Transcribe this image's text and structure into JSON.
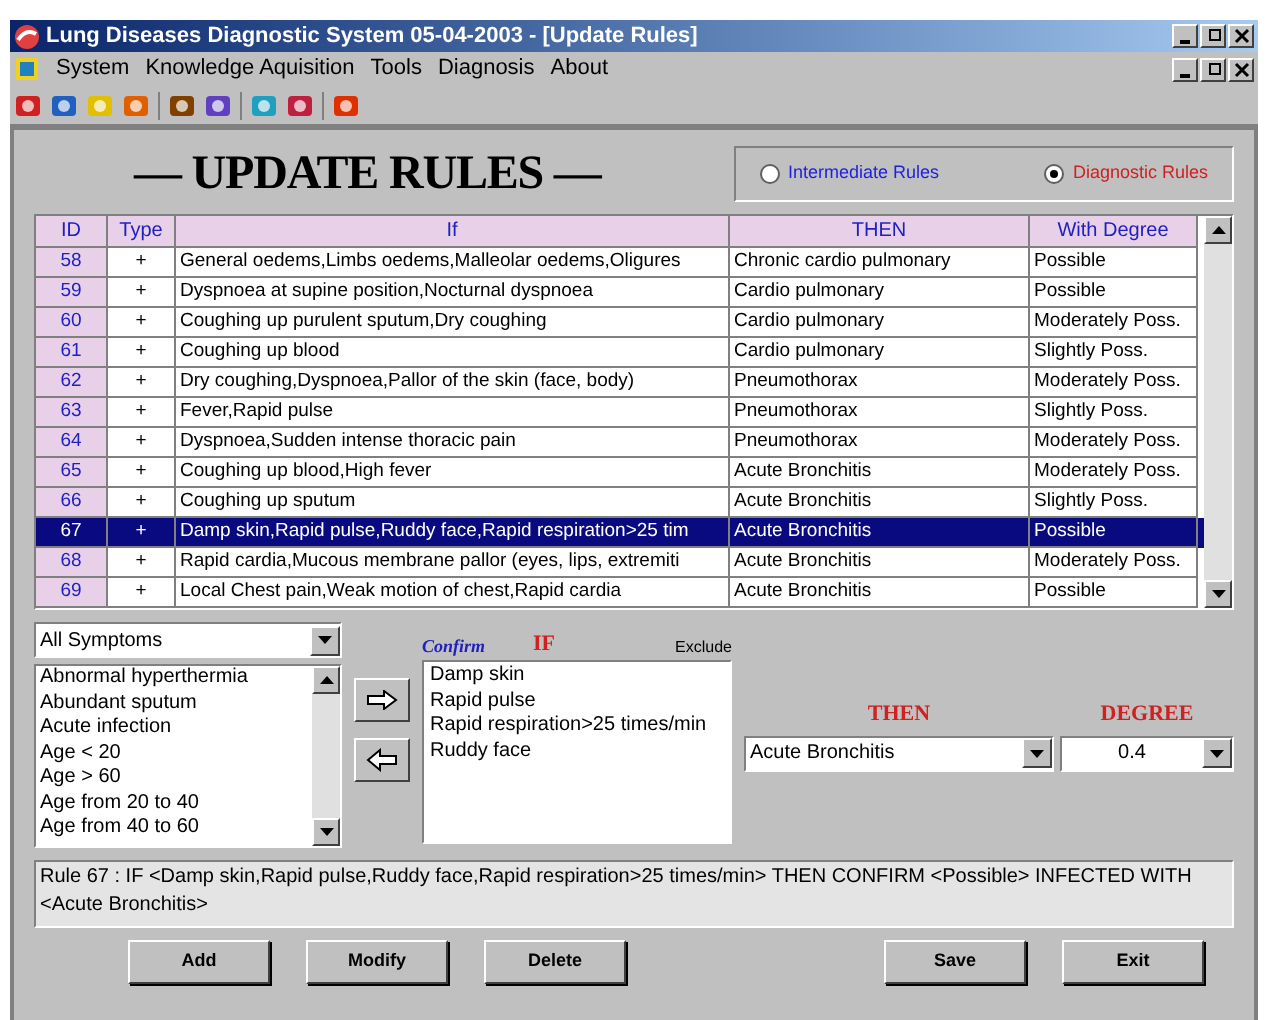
{
  "window": {
    "title": "Lung Diseases Diagnostic System 05-04-2003 - [Update Rules]"
  },
  "menu": [
    "System",
    "Knowledge Aquisition",
    "Tools",
    "Diagnosis",
    "About"
  ],
  "heading": "— UPDATE RULES —",
  "rule_types": [
    {
      "label": "Intermediate Rules",
      "selected": false,
      "color": "#2020e0"
    },
    {
      "label": "Diagnostic Rules",
      "selected": true,
      "color": "#d02020"
    }
  ],
  "table": {
    "columns": [
      "ID",
      "Type",
      "If",
      "THEN",
      "With Degree"
    ],
    "rows": [
      {
        "cells": [
          "58",
          "+",
          "General oedems,Limbs oedems,Malleolar oedems,Oligures",
          "Chronic cardio pulmonary",
          "Possible"
        ],
        "selected": false
      },
      {
        "cells": [
          "59",
          "+",
          "Dyspnoea at supine position,Nocturnal dyspnoea",
          "Cardio pulmonary",
          "Possible"
        ],
        "selected": false
      },
      {
        "cells": [
          "60",
          "+",
          "Coughing up purulent sputum,Dry coughing",
          "Cardio pulmonary",
          "Moderately Poss."
        ],
        "selected": false
      },
      {
        "cells": [
          "61",
          "+",
          "Coughing up blood",
          "Cardio pulmonary",
          "Slightly Poss."
        ],
        "selected": false
      },
      {
        "cells": [
          "62",
          "+",
          "Dry coughing,Dyspnoea,Pallor of the skin (face, body)",
          "Pneumothorax",
          "Moderately Poss."
        ],
        "selected": false
      },
      {
        "cells": [
          "63",
          "+",
          "Fever,Rapid pulse",
          "Pneumothorax",
          "Slightly Poss."
        ],
        "selected": false
      },
      {
        "cells": [
          "64",
          "+",
          "Dyspnoea,Sudden intense thoracic pain",
          "Pneumothorax",
          "Moderately Poss."
        ],
        "selected": false
      },
      {
        "cells": [
          "65",
          "+",
          "Coughing up blood,High fever",
          "Acute Bronchitis",
          "Moderately Poss."
        ],
        "selected": false
      },
      {
        "cells": [
          "66",
          "+",
          "Coughing up sputum",
          "Acute Bronchitis",
          "Slightly Poss."
        ],
        "selected": false
      },
      {
        "cells": [
          "67",
          "+",
          "Damp skin,Rapid pulse,Ruddy face,Rapid respiration>25 tim",
          "Acute Bronchitis",
          "Possible"
        ],
        "selected": true
      },
      {
        "cells": [
          "68",
          "+",
          "Rapid cardia,Mucous membrane pallor (eyes, lips, extremiti",
          "Acute Bronchitis",
          "Moderately Poss."
        ],
        "selected": false
      },
      {
        "cells": [
          "69",
          "+",
          "Local Chest pain,Weak motion of chest,Rapid cardia",
          "Acute Bronchitis",
          "Possible"
        ],
        "selected": false
      }
    ]
  },
  "symptom_filter": "All Symptoms",
  "symptoms": [
    "Abnormal hyperthermia",
    "Abundant sputum",
    "Acute infection",
    "Age < 20",
    "Age > 60",
    "Age from 20 to 40",
    "Age from 40 to 60"
  ],
  "confirm_label": "Confirm",
  "if_label": "IF",
  "exclude_label": "Exclude",
  "if_items": [
    "Damp skin",
    "Rapid pulse",
    "Rapid respiration>25 times/min",
    "Ruddy face"
  ],
  "then_label": "THEN",
  "then_value": "Acute Bronchitis",
  "degree_label": "DEGREE",
  "degree_value": "0.4",
  "rule_text": "Rule 67 : IF <Damp skin,Rapid pulse,Ruddy face,Rapid respiration>25 times/min> THEN CONFIRM <Possible> INFECTED WITH <Acute Bronchitis>",
  "buttons": [
    "Add",
    "Modify",
    "Delete",
    "Save",
    "Exit"
  ]
}
